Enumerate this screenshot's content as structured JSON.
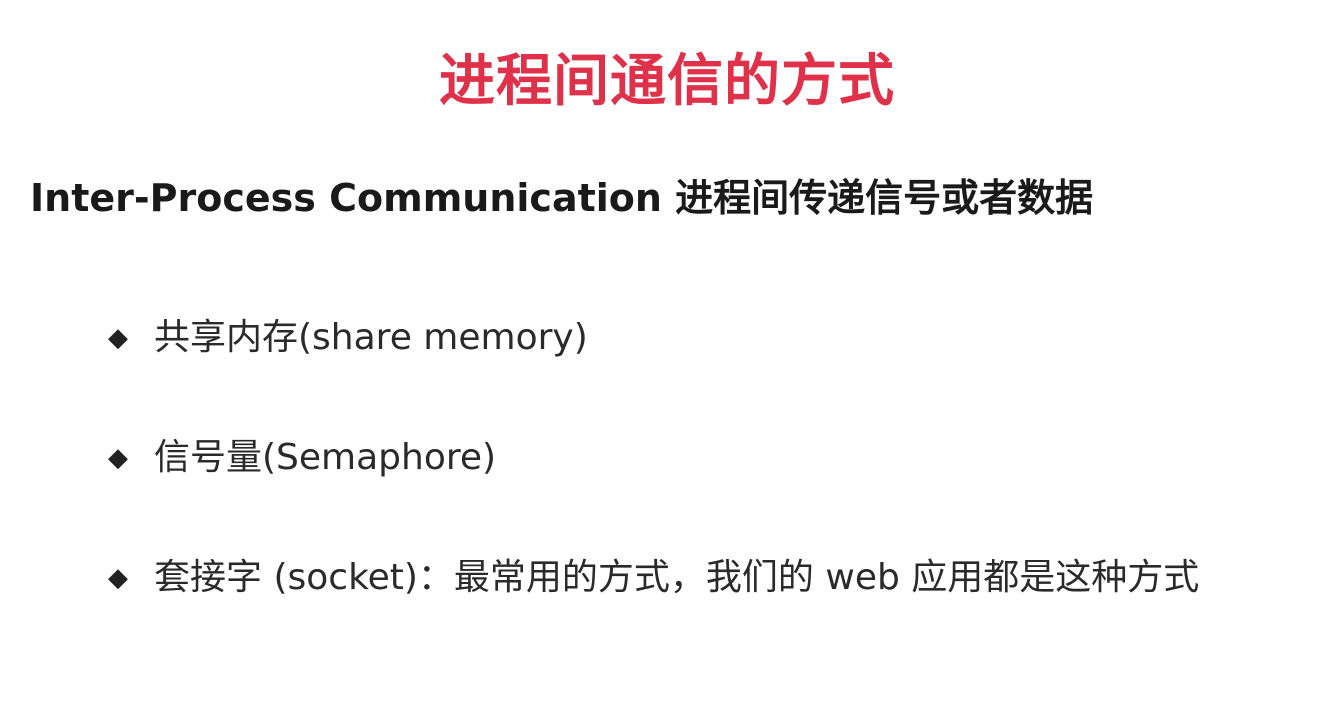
{
  "slide": {
    "title": "进程间通信的方式",
    "subtitle": "Inter-Process Communication 进程间传递信号或者数据",
    "bullet_marker": "◆",
    "bullets": [
      {
        "text": "共享内存(share memory)"
      },
      {
        "text": "信号量(Semaphore)"
      },
      {
        "text": "套接字 (socket)：最常用的方式，我们的 web 应用都是这种方式"
      }
    ]
  },
  "colors": {
    "title": "#e0314a",
    "text": "#1a1a1a",
    "background": "#ffffff"
  }
}
